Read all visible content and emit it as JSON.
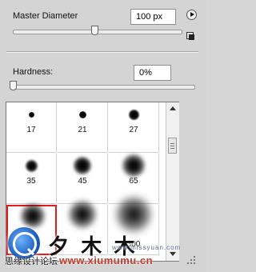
{
  "master_diameter": {
    "label": "Master Diameter",
    "value": "100 px",
    "slider_fraction": 0.48
  },
  "hardness": {
    "label": "Hardness:",
    "value": "0%",
    "slider_fraction": 0.0
  },
  "icons": {
    "menu": "flyout-menu-arrow-icon",
    "reset": "reset-sample-size-icon"
  },
  "presets": [
    {
      "size": "17"
    },
    {
      "size": "21"
    },
    {
      "size": "27"
    },
    {
      "size": "35"
    },
    {
      "size": "45"
    },
    {
      "size": "65"
    },
    {
      "size": ""
    },
    {
      "size": ""
    },
    {
      "size": "300"
    }
  ],
  "selected_preset_index": 6,
  "selection_color": "#e21d1d",
  "watermark": {
    "cjk_title": "夕 木 木",
    "cn_small": "思缘设计论坛",
    "domain": "www.xiumumu.cn",
    "site": "www.missyuan.com"
  }
}
